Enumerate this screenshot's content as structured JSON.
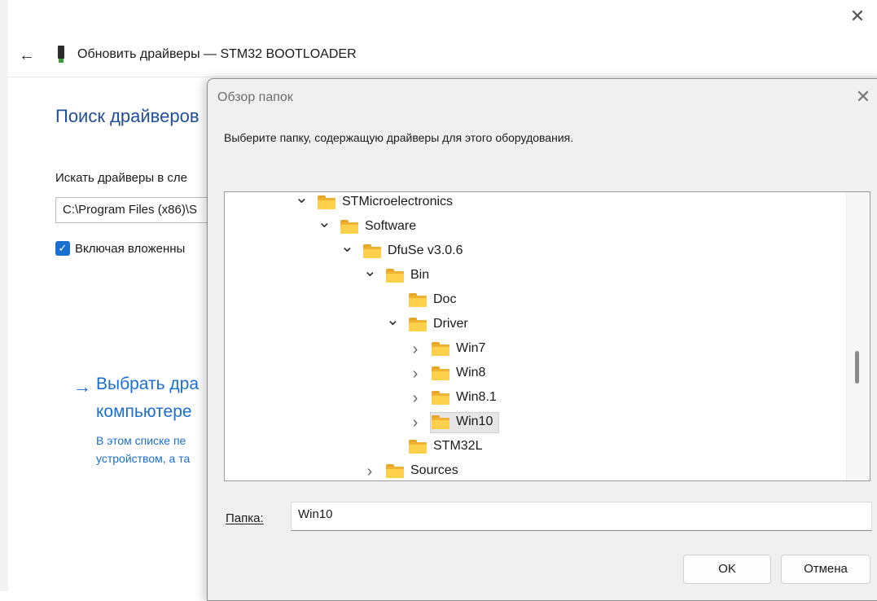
{
  "wizard": {
    "title": "Обновить драйверы — STM32  BOOTLOADER",
    "close_glyph": "✕",
    "back_glyph": "←",
    "search_heading": "Поиск драйверов",
    "search_label": "Искать драйверы в сле",
    "path_value": "C:\\Program Files (x86)\\S",
    "include_subfolders_label": "Включая вложенны",
    "include_subfolders_checked": true,
    "choose_arrow": "→",
    "choose_line1": "Выбрать дра",
    "choose_line2": "компьютере",
    "choose_desc_line1": "В этом списке пе",
    "choose_desc_line2": "устройством, а та"
  },
  "dialog": {
    "title": "Обзор папок",
    "close_glyph": "✕",
    "prompt": "Выберите папку, содержащую драйверы для этого оборудования.",
    "tree": [
      {
        "name": "STMicroelectronics",
        "level": 0,
        "expanded": true,
        "has_children": true,
        "selected": false
      },
      {
        "name": "Software",
        "level": 1,
        "expanded": true,
        "has_children": true,
        "selected": false
      },
      {
        "name": "DfuSe v3.0.6",
        "level": 2,
        "expanded": true,
        "has_children": true,
        "selected": false
      },
      {
        "name": "Bin",
        "level": 3,
        "expanded": true,
        "has_children": true,
        "selected": false
      },
      {
        "name": "Doc",
        "level": 4,
        "expanded": false,
        "has_children": false,
        "selected": false
      },
      {
        "name": "Driver",
        "level": 4,
        "expanded": true,
        "has_children": true,
        "selected": false
      },
      {
        "name": "Win7",
        "level": 5,
        "expanded": false,
        "has_children": true,
        "selected": false
      },
      {
        "name": "Win8",
        "level": 5,
        "expanded": false,
        "has_children": true,
        "selected": false
      },
      {
        "name": "Win8.1",
        "level": 5,
        "expanded": false,
        "has_children": true,
        "selected": false
      },
      {
        "name": "Win10",
        "level": 5,
        "expanded": false,
        "has_children": true,
        "selected": true
      },
      {
        "name": "STM32L",
        "level": 4,
        "expanded": false,
        "has_children": false,
        "selected": false
      },
      {
        "name": "Sources",
        "level": 3,
        "expanded": false,
        "has_children": true,
        "selected": false
      }
    ],
    "folder_label": "Папка:",
    "folder_value": "Win10",
    "ok_label": "OK",
    "cancel_label": "Отмена"
  },
  "colors": {
    "accent": "#1a6fd0",
    "heading": "#1f4e9a",
    "folder": "#ffd04a",
    "selection": "#e6e6e6"
  }
}
